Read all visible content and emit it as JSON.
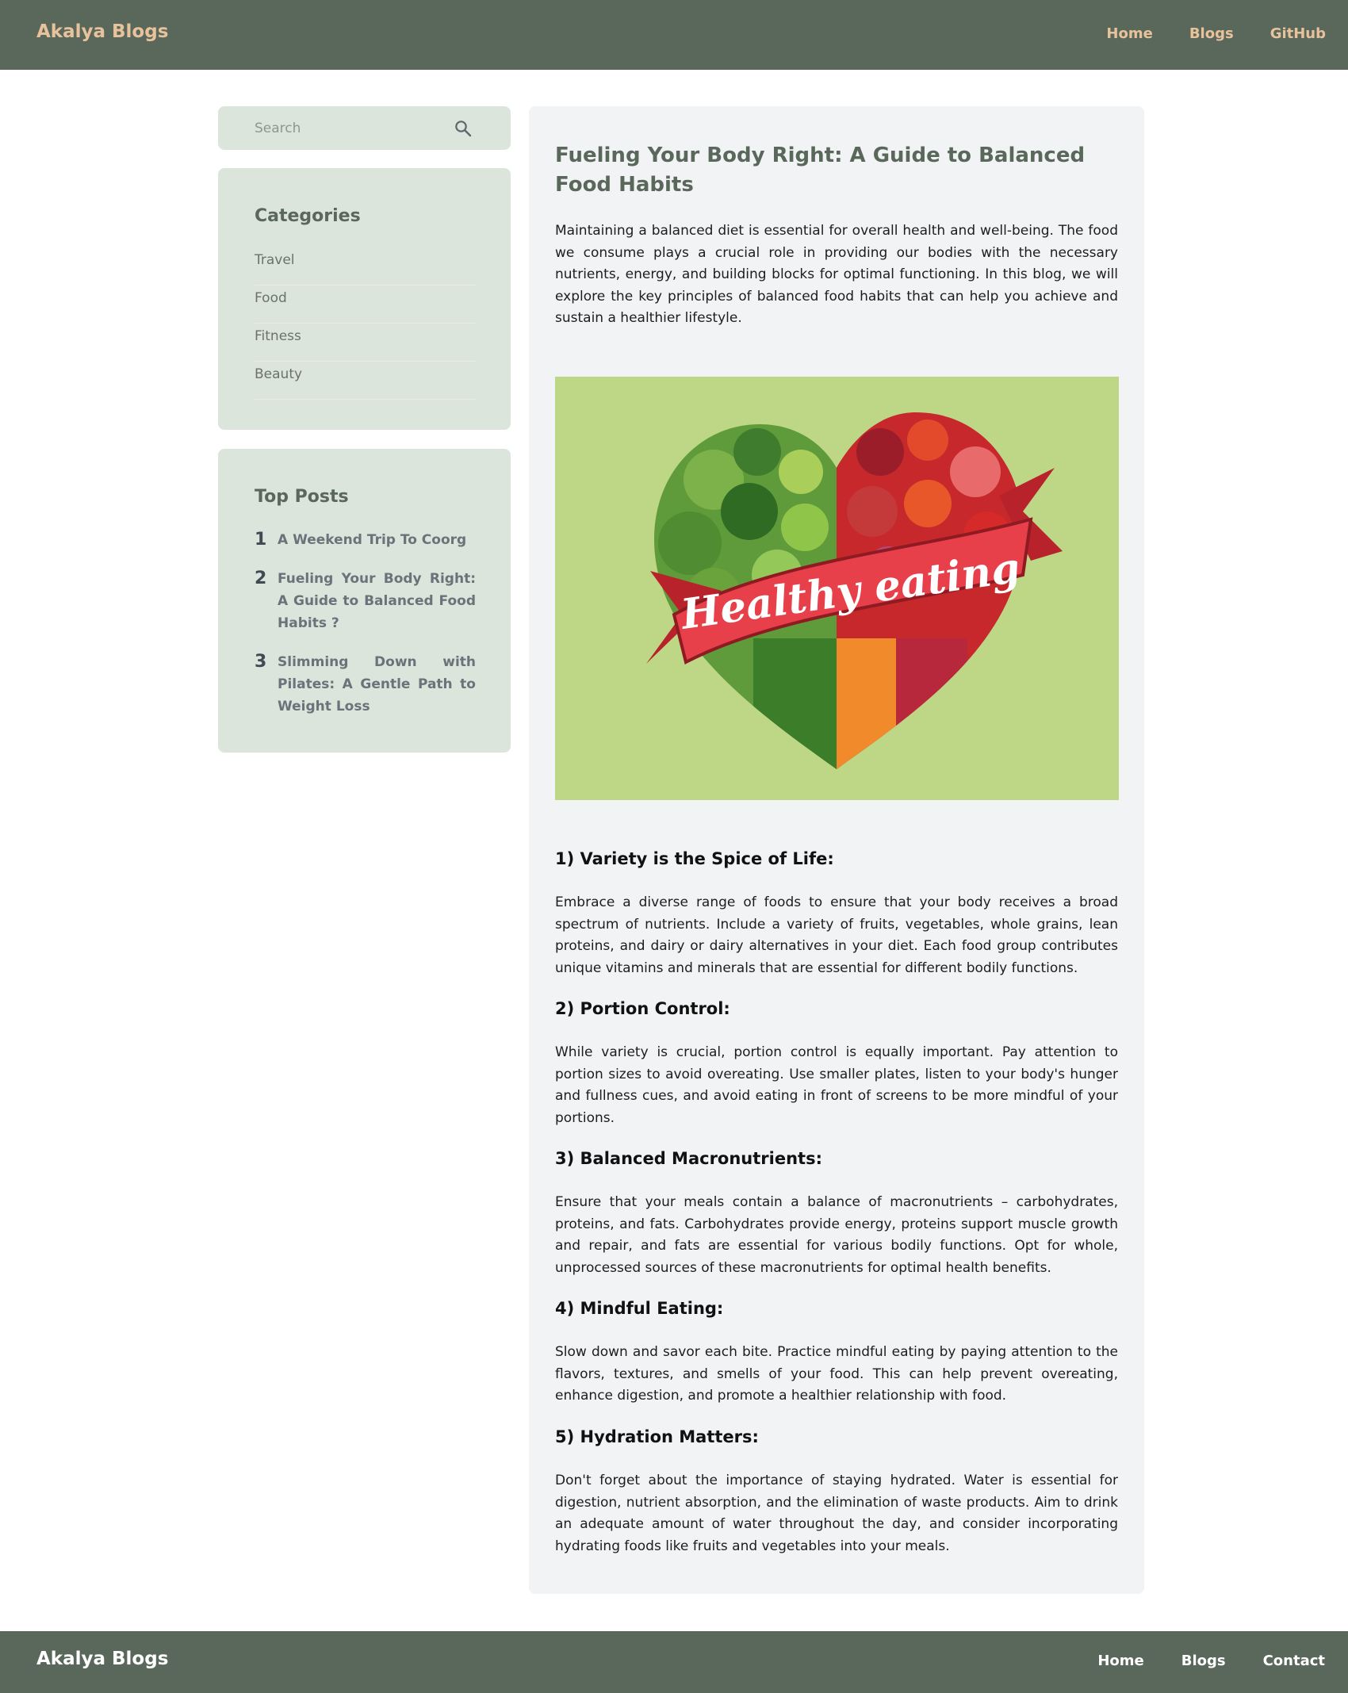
{
  "header": {
    "brand": "Akalya Blogs",
    "nav": [
      "Home",
      "Blogs",
      "GitHub"
    ]
  },
  "search": {
    "placeholder": "Search"
  },
  "categories": {
    "title": "Categories",
    "items": [
      "Travel",
      "Food",
      "Fitness",
      "Beauty"
    ]
  },
  "top_posts": {
    "title": "Top Posts",
    "items": [
      {
        "num": "1",
        "title": "A Weekend Trip To Coorg"
      },
      {
        "num": "2",
        "title": "Fueling Your Body Right: A Guide to Balanced Food Habits ?"
      },
      {
        "num": "3",
        "title": "Slimming Down with Pilates: A Gentle Path to Weight Loss"
      }
    ]
  },
  "article": {
    "title": "Fueling Your Body Right: A Guide to Balanced Food Habits",
    "intro": "Maintaining a balanced diet is essential for overall health and well-being. The food we consume plays a crucial role in providing our bodies with the necessary nutrients, energy, and building blocks for optimal functioning. In this blog, we will explore the key principles of balanced food habits that can help you achieve and sustain a healthier lifestyle.",
    "image_caption": "Healthy eating",
    "sections": [
      {
        "heading": "1) Variety is the Spice of Life:",
        "body": "Embrace a diverse range of foods to ensure that your body receives a broad spectrum of nutrients. Include a variety of fruits, vegetables, whole grains, lean proteins, and dairy or dairy alternatives in your diet. Each food group contributes unique vitamins and minerals that are essential for different bodily functions."
      },
      {
        "heading": "2) Portion Control:",
        "body": "While variety is crucial, portion control is equally important. Pay attention to portion sizes to avoid overeating. Use smaller plates, listen to your body's hunger and fullness cues, and avoid eating in front of screens to be more mindful of your portions."
      },
      {
        "heading": "3) Balanced Macronutrients:",
        "body": "Ensure that your meals contain a balance of macronutrients – carbohydrates, proteins, and fats. Carbohydrates provide energy, proteins support muscle growth and repair, and fats are essential for various bodily functions. Opt for whole, unprocessed sources of these macronutrients for optimal health benefits."
      },
      {
        "heading": "4) Mindful Eating:",
        "body": "Slow down and savor each bite. Practice mindful eating by paying attention to the flavors, textures, and smells of your food. This can help prevent overeating, enhance digestion, and promote a healthier relationship with food."
      },
      {
        "heading": "5) Hydration Matters:",
        "body": "Don't forget about the importance of staying hydrated. Water is essential for digestion, nutrient absorption, and the elimination of waste products. Aim to drink an adequate amount of water throughout the day, and consider incorporating hydrating foods like fruits and vegetables into your meals."
      }
    ]
  },
  "footer": {
    "brand": "Akalya Blogs",
    "nav": [
      "Home",
      "Blogs",
      "Contact"
    ]
  },
  "colors": {
    "header_bg": "#5a685c",
    "brand_accent": "#e8c29b",
    "card_bg": "#dce5dc",
    "article_bg": "#f1f3f4",
    "hero_bg": "#bdd786"
  },
  "icons": {
    "search": "search-icon"
  }
}
